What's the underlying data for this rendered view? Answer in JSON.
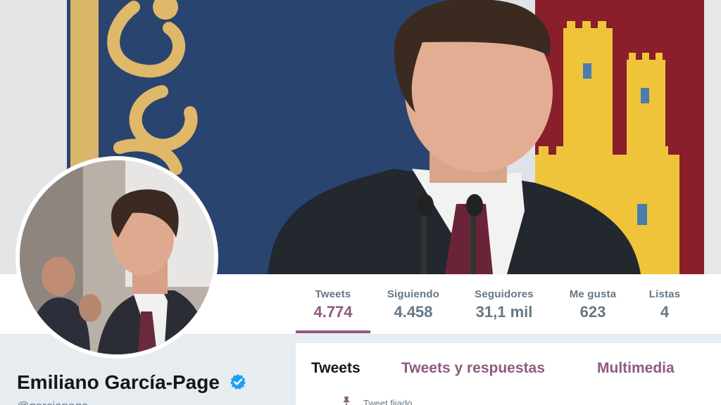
{
  "profile": {
    "name": "Emiliano García-Page",
    "handle": "@garciapage",
    "verified": true
  },
  "stats": [
    {
      "label": "Tweets",
      "value": "4.774",
      "active": true
    },
    {
      "label": "Siguiendo",
      "value": "4.458",
      "active": false
    },
    {
      "label": "Seguidores",
      "value": "31,1 mil",
      "active": false
    },
    {
      "label": "Me gusta",
      "value": "623",
      "active": false
    },
    {
      "label": "Listas",
      "value": "4",
      "active": false
    }
  ],
  "tabs": [
    {
      "label": "Tweets",
      "active": true
    },
    {
      "label": "Tweets y respuestas",
      "active": false
    },
    {
      "label": "Multimedia",
      "active": false
    }
  ],
  "timeline": {
    "pinned_label": "Tweet fijado"
  },
  "colors": {
    "accent": "#8e5a7e",
    "verified": "#1da1f2",
    "muted": "#657786",
    "text": "#14171a"
  }
}
